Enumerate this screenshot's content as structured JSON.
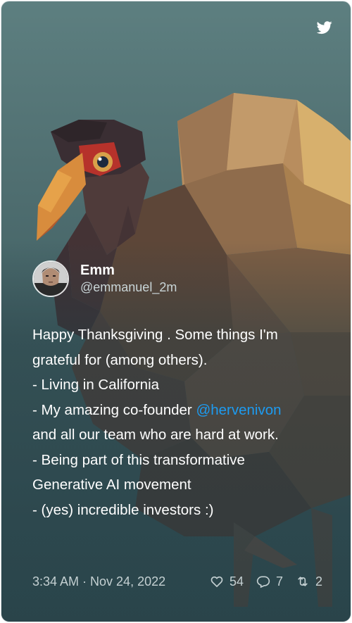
{
  "author": {
    "name": "Emm",
    "handle": "@emmanuel_2m"
  },
  "tweet": {
    "line1": "Happy Thanksgiving . Some things I'm",
    "line2": "grateful for (among others).",
    "line3": "- Living in California",
    "line4_prefix": "- My amazing co-founder ",
    "line4_mention": "@hervenivon",
    "line5": "and all our team who are hard at work.",
    "line6": "- Being part of this transformative",
    "line7": "Generative AI movement",
    "line8": "- (yes) incredible investors :)"
  },
  "footer": {
    "timestamp": "3:34 AM · Nov 24, 2022",
    "likes": "54",
    "replies": "7",
    "retweets": "2"
  },
  "icons": {
    "brand": "twitter-bird-icon",
    "like": "heart-icon",
    "reply": "speech-bubble-icon",
    "retweet": "retweet-icon"
  },
  "colors": {
    "mention": "#1d9bf0",
    "text": "#ffffff",
    "muted": "#c4d0d2"
  }
}
